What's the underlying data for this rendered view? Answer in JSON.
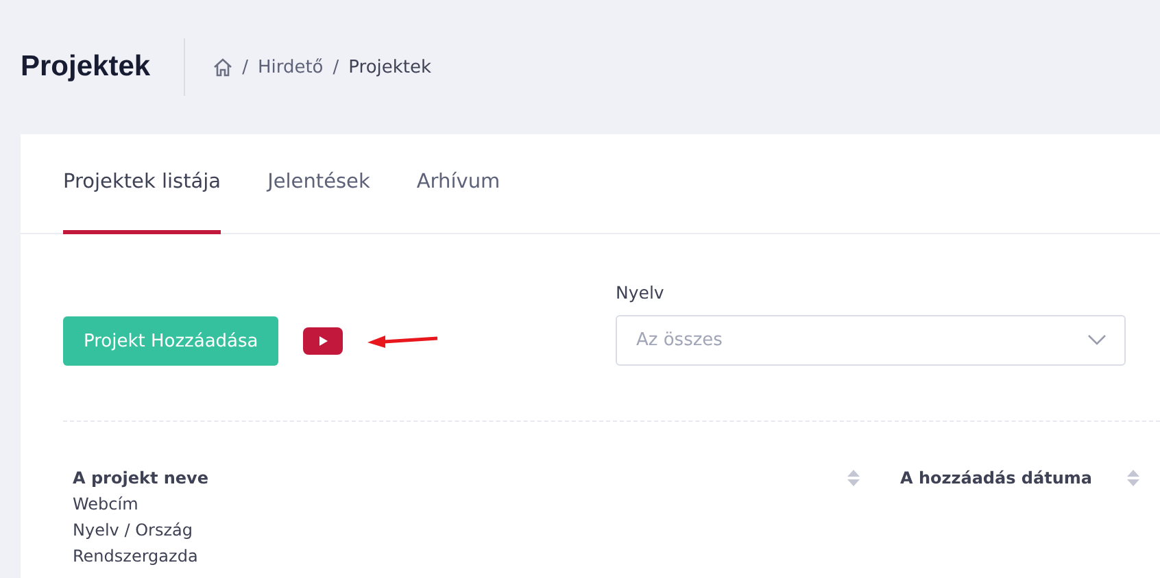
{
  "page_title": "Projektek",
  "breadcrumb": [
    {
      "separator": "/",
      "label": "Hirdető"
    },
    {
      "separator": "/",
      "label": "Projektek"
    }
  ],
  "tabs": [
    {
      "label": "Projektek listája",
      "selected": true
    },
    {
      "label": "Jelentések",
      "selected": false
    },
    {
      "label": "Arhívum",
      "selected": false
    }
  ],
  "add_button": "Projekt Hozzáadása",
  "language_filter": {
    "label": "Nyelv",
    "placeholder": "Az összes"
  },
  "table": {
    "columns": [
      {
        "title": "A projekt neve",
        "lines": [
          "Webcím",
          "Nyelv / Ország",
          "Rendszergazda"
        ]
      },
      {
        "title": "A hozzáadás dátuma"
      }
    ]
  }
}
